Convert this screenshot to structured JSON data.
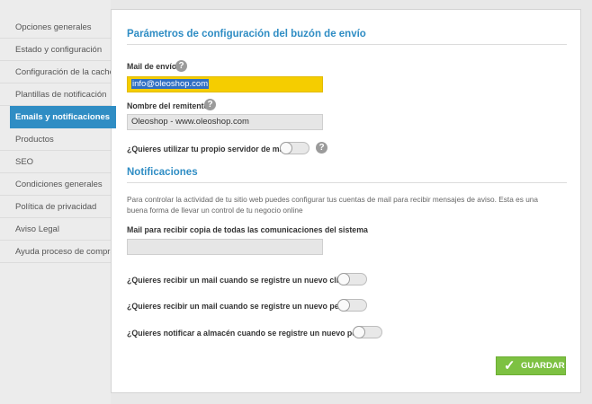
{
  "sidebar": {
    "items": [
      {
        "label": "Opciones generales"
      },
      {
        "label": "Estado y configuración"
      },
      {
        "label": "Configuración de la caché"
      },
      {
        "label": "Plantillas de notificación"
      },
      {
        "label": "Emails y notificaciones",
        "active": true
      },
      {
        "label": "Productos"
      },
      {
        "label": "SEO"
      },
      {
        "label": "Condiciones generales"
      },
      {
        "label": "Política de privacidad"
      },
      {
        "label": "Aviso Legal"
      },
      {
        "label": "Ayuda proceso de compra"
      }
    ]
  },
  "mailbox": {
    "title": "Parámetros de configuración del buzón de envío",
    "mail_label": "Mail de envío",
    "mail_value": "info@oleoshop.com",
    "sender_label": "Nombre del remitente",
    "sender_value": "Oleoshop - www.oleoshop.com",
    "own_server_label": "¿Quieres utilizar tu propio servidor de mail?",
    "own_server_on": false
  },
  "notifications": {
    "title": "Notificaciones",
    "description": "Para controlar la actividad de tu sitio web puedes configurar tus cuentas de mail para recibir mensajes de aviso. Esta es una buena forma de llevar un control de tu negocio online",
    "copy_label": "Mail para recibir copia de todas las comunicaciones del sistema",
    "copy_value": "",
    "new_client_label": "¿Quieres recibir un mail cuando se registre un nuevo cliente?",
    "new_client_on": false,
    "new_order_label": "¿Quieres recibir un mail cuando se registre un nuevo pedido?",
    "new_order_on": false,
    "warehouse_label": "¿Quieres notificar a almacén cuando se registre un nuevo pedido?",
    "warehouse_on": false
  },
  "icons": {
    "help": "?",
    "check": "✓"
  },
  "actions": {
    "save_label": "GUARDAR"
  },
  "colors": {
    "accent": "#2f8dc4",
    "highlight_field": "#f5cd00",
    "save_button": "#7dc142"
  }
}
